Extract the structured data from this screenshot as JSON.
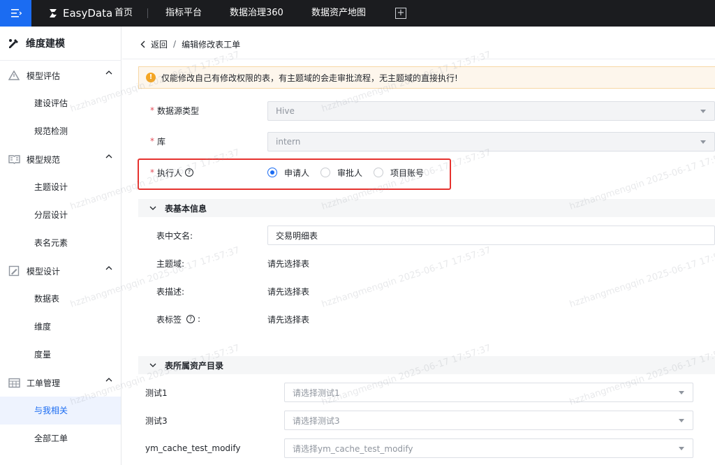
{
  "topbar": {
    "brand": "EasyData",
    "nav": [
      "首页",
      "指标平台",
      "数据治理360",
      "数据资产地图"
    ],
    "add_tab": "+"
  },
  "sidebar": {
    "title": "维度建模",
    "groups": [
      {
        "label": "模型评估",
        "items": [
          "建设评估",
          "规范检测"
        ]
      },
      {
        "label": "模型规范",
        "items": [
          "主题设计",
          "分层设计",
          "表名元素"
        ]
      },
      {
        "label": "模型设计",
        "items": [
          "数据表",
          "维度",
          "度量"
        ]
      },
      {
        "label": "工单管理",
        "items": [
          "与我相关",
          "全部工单"
        ]
      }
    ],
    "active_item": "与我相关"
  },
  "breadcrumb": {
    "back": "返回",
    "separator": "/",
    "current": "编辑修改表工单"
  },
  "alert": {
    "text": "仅能修改自己有修改权限的表，有主题域的会走审批流程，无主题域的直接执行!"
  },
  "form": {
    "datasource": {
      "label": "数据源类型",
      "value": "Hive"
    },
    "database": {
      "label": "库",
      "value": "intern"
    },
    "executor": {
      "label": "执行人",
      "options": [
        "申请人",
        "审批人",
        "项目账号"
      ],
      "selected": "申请人"
    }
  },
  "basic_info": {
    "title": "表基本信息",
    "cn_name": {
      "label": "表中文名:",
      "value": "交易明细表"
    },
    "domain": {
      "label": "主题域:",
      "value": "请先选择表"
    },
    "desc": {
      "label": "表描述:",
      "value": "请先选择表"
    },
    "tags": {
      "label": "表标签",
      "suffix": ":",
      "value": "请先选择表"
    }
  },
  "catalog": {
    "title": "表所属资产目录",
    "rows": [
      {
        "label": "测试1",
        "placeholder": "请选择测试1"
      },
      {
        "label": "测试3",
        "placeholder": "请选择测试3"
      },
      {
        "label": "ym_cache_test_modify",
        "placeholder": "请选择ym_cache_test_modify"
      }
    ]
  },
  "watermark": "hzzhangmengqin 2025-06-17 17:57:37"
}
